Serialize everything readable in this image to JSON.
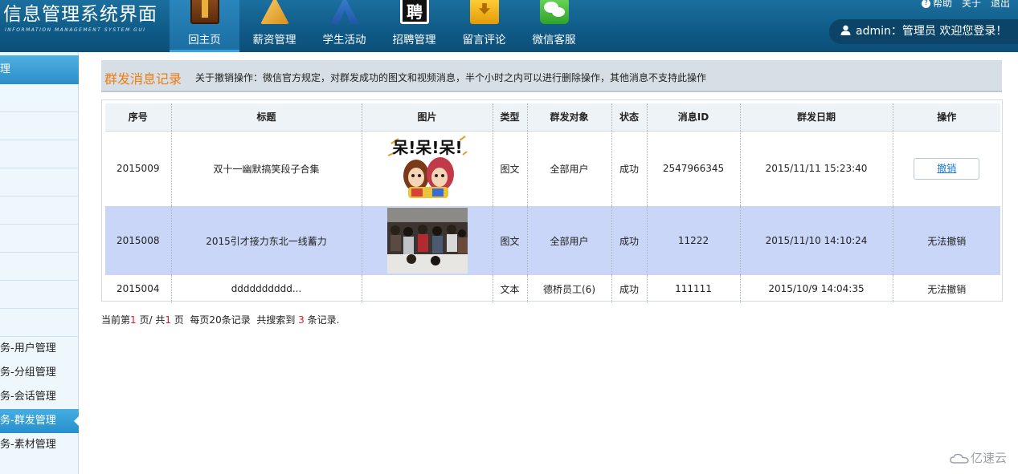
{
  "header": {
    "title": "信息管理系统界面",
    "subtitle": "INFORMATION MANAGEMENT SYSTEM GUI",
    "nav": [
      {
        "label": "回主页",
        "icon": "book-icon",
        "active": true
      },
      {
        "label": "薪资管理",
        "icon": "ruler-triangle-icon",
        "active": false
      },
      {
        "label": "学生活动",
        "icon": "compass-tools-icon",
        "active": false
      },
      {
        "label": "招聘管理",
        "icon": "recruit-character-icon",
        "active": false
      },
      {
        "label": "留言评论",
        "icon": "download-box-icon",
        "active": false
      },
      {
        "label": "微信客服",
        "icon": "wechat-icon",
        "active": false
      }
    ],
    "toplinks": {
      "help": "帮助",
      "about": "关于",
      "logout": "退出"
    },
    "user": "admin：管理员  欢迎您登录！"
  },
  "sidebar": {
    "head": "理",
    "items": [
      {
        "label": "务-用户管理",
        "active": false
      },
      {
        "label": "务-分组管理",
        "active": false
      },
      {
        "label": "务-会话管理",
        "active": false
      },
      {
        "label": "务-群发管理",
        "active": true
      },
      {
        "label": "务-素材管理",
        "active": false
      }
    ]
  },
  "panel": {
    "title": "群发消息记录",
    "note": "关于撤销操作：微信官方规定，对群发成功的图文和视频消息，半个小时之内可以进行删除操作，其他消息不支持此操作"
  },
  "table": {
    "headers": [
      "序号",
      "标题",
      "图片",
      "类型",
      "群发对象",
      "状态",
      "消息ID",
      "群发日期",
      "操作"
    ],
    "rows": [
      {
        "id": "2015009",
        "title": "双十一幽默搞笑段子合集",
        "image": "cartoon-girls-image",
        "type": "图文",
        "target": "全部用户",
        "status": "成功",
        "msg_id": "2547966345",
        "date": "2015/11/11 15:23:40",
        "action": "撤销",
        "action_is_button": true
      },
      {
        "id": "2015008",
        "title": "2015引才接力东北一线蓄力",
        "image": "job-fair-crowd-photo",
        "type": "图文",
        "target": "全部用户",
        "status": "成功",
        "msg_id": "11222",
        "date": "2015/11/10 14:10:24",
        "action": "无法撤销",
        "action_is_button": false
      },
      {
        "id": "2015004",
        "title": "dddddddddd...",
        "image": "",
        "type": "文本",
        "target": "德桥员工(6)",
        "status": "成功",
        "msg_id": "111111",
        "date": "2015/10/9 14:04:35",
        "action": "无法撤销",
        "action_is_button": false
      }
    ]
  },
  "pager": {
    "prefix": "当前第",
    "current": "1",
    "mid": " 页/ 共",
    "total": "1",
    "suffix": " 页  每页20条记录  共搜索到 ",
    "count": "3",
    "end": " 条记录."
  },
  "watermark": "亿速云",
  "colors": {
    "header": "#0f5a86",
    "accent": "#2b8ec8",
    "title_orange": "#f07c10",
    "highlight_row": "#c9d6f7",
    "pager_red": "#d8191f"
  }
}
